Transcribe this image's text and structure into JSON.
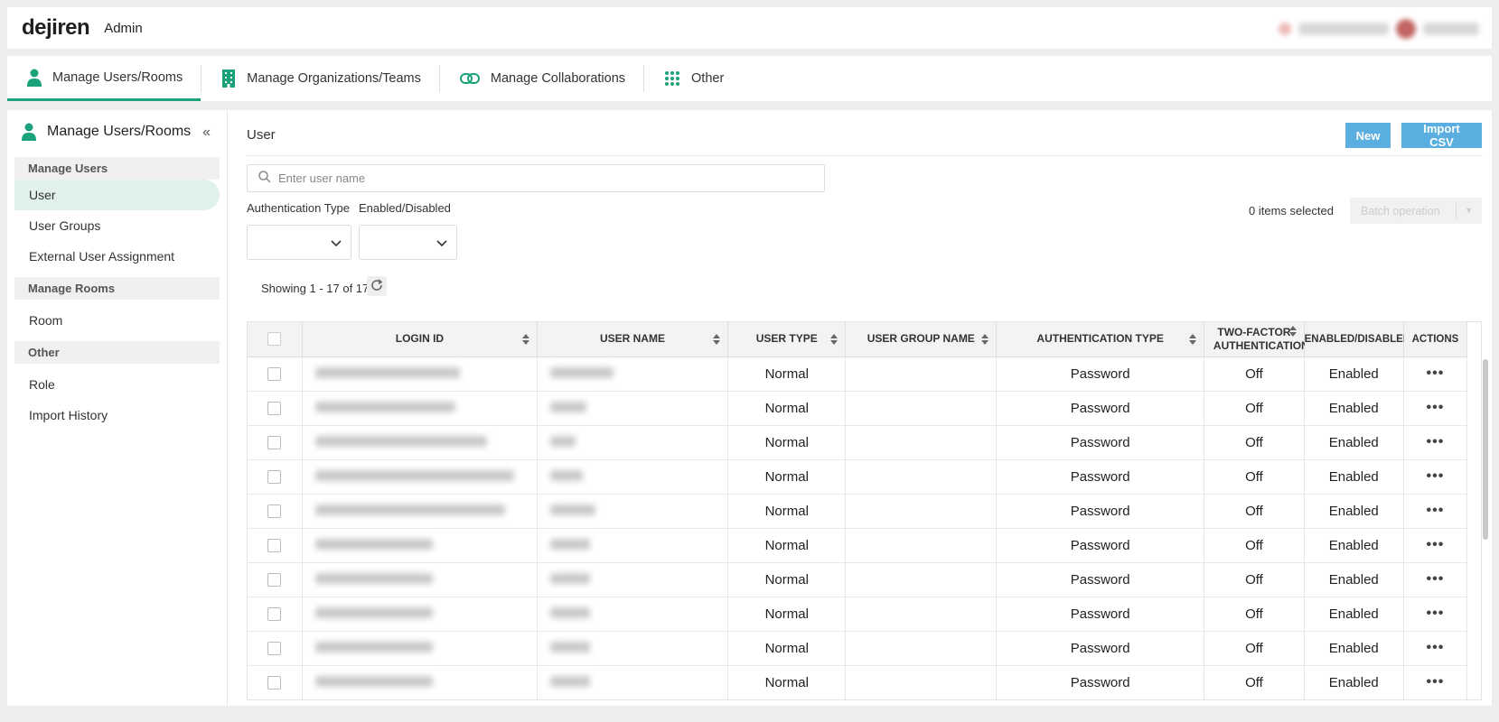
{
  "app": {
    "logo": "dejiren",
    "section": "Admin"
  },
  "nav": {
    "tabs": [
      {
        "label": "Manage Users/Rooms",
        "icon": "person-icon"
      },
      {
        "label": "Manage Organizations/Teams",
        "icon": "building-icon"
      },
      {
        "label": "Manage Collaborations",
        "icon": "link-icon"
      },
      {
        "label": "Other",
        "icon": "grid-icon"
      }
    ],
    "active_color": "#1aa37a"
  },
  "sidebar": {
    "title": "Manage Users/Rooms",
    "sections": [
      {
        "label": "Manage Users",
        "items": [
          "User",
          "User Groups",
          "External User Assignment"
        ]
      },
      {
        "label": "Manage Rooms",
        "items": [
          "Room"
        ]
      },
      {
        "label": "Other",
        "items": [
          "Role",
          "Import History"
        ]
      }
    ],
    "active_item": "User"
  },
  "main": {
    "title": "User",
    "new_button": "New",
    "import_button": "Import CSV",
    "search_placeholder": "Enter user name",
    "filters": {
      "auth_type_label": "Authentication Type",
      "enabled_label": "Enabled/Disabled"
    },
    "items_selected": "0 items selected",
    "batch_operation": "Batch operation",
    "showing": "Showing 1 - 17 of 17",
    "button_color": "#5aaee0"
  },
  "table": {
    "columns": [
      "LOGIN ID",
      "USER NAME",
      "USER TYPE",
      "USER GROUP NAME",
      "AUTHENTICATION TYPE",
      "TWO-FACTOR AUTHENTICATION",
      "ENABLED/DISABLED",
      "ACTIONS"
    ],
    "rows": [
      {
        "user_type": "Normal",
        "group": "",
        "auth": "Password",
        "two_factor": "Off",
        "status": "Enabled"
      },
      {
        "user_type": "Normal",
        "group": "",
        "auth": "Password",
        "two_factor": "Off",
        "status": "Enabled"
      },
      {
        "user_type": "Normal",
        "group": "",
        "auth": "Password",
        "two_factor": "Off",
        "status": "Enabled"
      },
      {
        "user_type": "Normal",
        "group": "",
        "auth": "Password",
        "two_factor": "Off",
        "status": "Enabled"
      },
      {
        "user_type": "Normal",
        "group": "",
        "auth": "Password",
        "two_factor": "Off",
        "status": "Enabled"
      },
      {
        "user_type": "Normal",
        "group": "",
        "auth": "Password",
        "two_factor": "Off",
        "status": "Enabled"
      },
      {
        "user_type": "Normal",
        "group": "",
        "auth": "Password",
        "two_factor": "Off",
        "status": "Enabled"
      },
      {
        "user_type": "Normal",
        "group": "",
        "auth": "Password",
        "two_factor": "Off",
        "status": "Enabled"
      },
      {
        "user_type": "Normal",
        "group": "",
        "auth": "Password",
        "two_factor": "Off",
        "status": "Enabled"
      },
      {
        "user_type": "Normal",
        "group": "",
        "auth": "Password",
        "two_factor": "Off",
        "status": "Enabled"
      }
    ],
    "actions_glyph": "•••"
  }
}
